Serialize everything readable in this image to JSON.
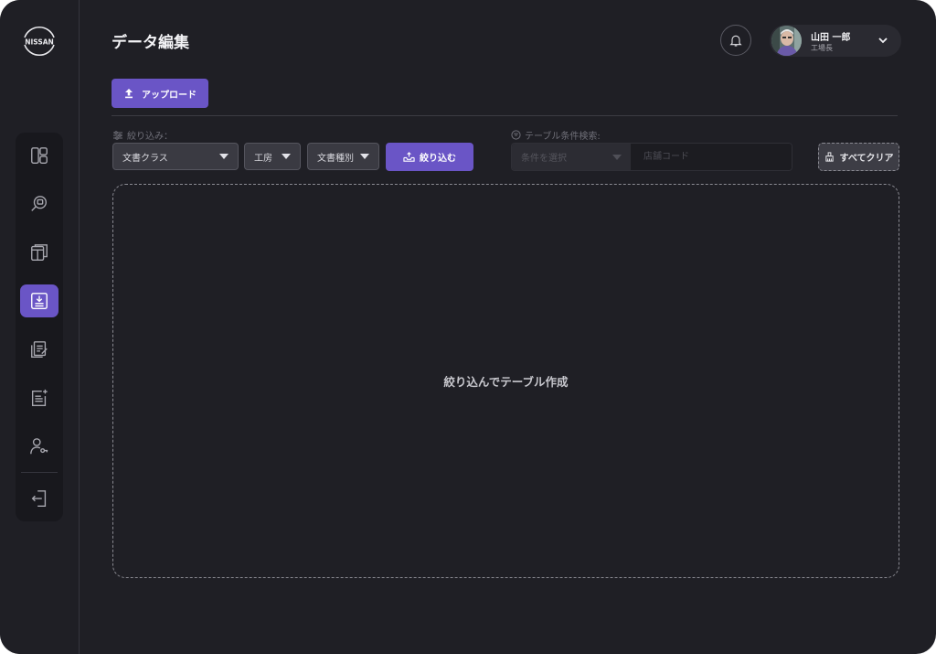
{
  "brand": {
    "logo_text": "NISSAN"
  },
  "header": {
    "title": "データ編集",
    "user": {
      "name": "山田 一郎",
      "role": "工場長"
    }
  },
  "toolbar": {
    "upload_label": "アップロード"
  },
  "filter": {
    "label": "絞り込み：",
    "selects": [
      {
        "value": "文書クラス"
      },
      {
        "value": "工房"
      },
      {
        "value": "文書種別"
      }
    ],
    "apply_label": "絞り込む"
  },
  "table_search": {
    "label": "テーブル条件検索:",
    "condition_placeholder": "条件を選択",
    "input_placeholder": "店舗コード"
  },
  "clear_label": "すべてクリア",
  "dropzone": {
    "text": "絞り込んでテーブル作成"
  },
  "sidebar": {
    "items": [
      {
        "icon": "dashboard-icon"
      },
      {
        "icon": "search-chat-icon"
      },
      {
        "icon": "browser-window-icon"
      },
      {
        "icon": "download-document-icon",
        "active": true
      },
      {
        "icon": "document-stack-edit-icon"
      },
      {
        "icon": "add-document-icon"
      },
      {
        "icon": "user-key-icon"
      },
      {
        "icon": "logout-icon"
      }
    ]
  },
  "colors": {
    "accent": "#6a55c6",
    "background": "#1f1f25",
    "rail": "#18181d"
  }
}
